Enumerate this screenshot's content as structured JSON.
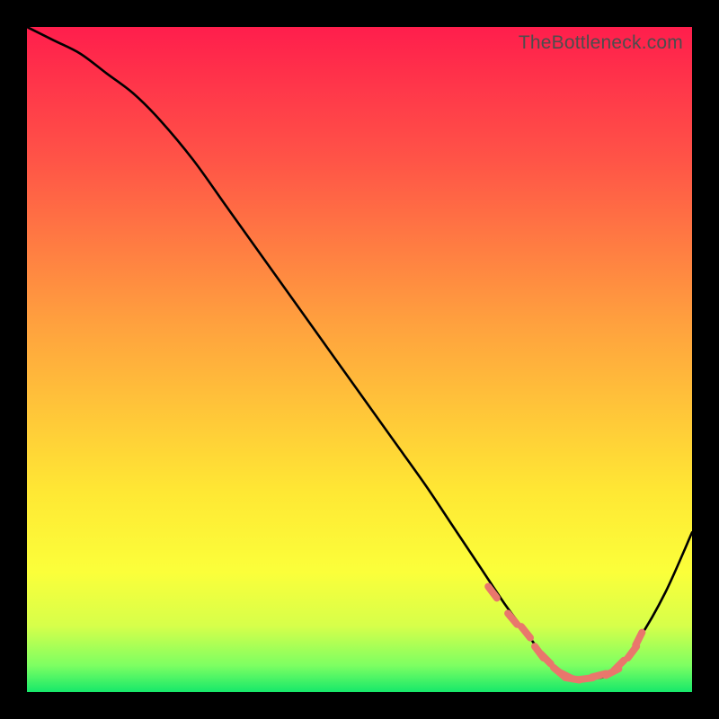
{
  "watermark": "TheBottleneck.com",
  "chart_data": {
    "type": "line",
    "title": "",
    "xlabel": "",
    "ylabel": "",
    "xlim": [
      0,
      100
    ],
    "ylim": [
      0,
      100
    ],
    "gradient_stops": [
      {
        "pos": 0.0,
        "color": "#ff1e4c"
      },
      {
        "pos": 0.2,
        "color": "#ff5447"
      },
      {
        "pos": 0.45,
        "color": "#ffa23e"
      },
      {
        "pos": 0.7,
        "color": "#ffe834"
      },
      {
        "pos": 0.82,
        "color": "#fbff3a"
      },
      {
        "pos": 0.9,
        "color": "#d7ff4a"
      },
      {
        "pos": 0.96,
        "color": "#7dff62"
      },
      {
        "pos": 1.0,
        "color": "#16e86a"
      }
    ],
    "series": [
      {
        "name": "bottleneck-curve",
        "x": [
          0,
          4,
          8,
          12,
          16,
          20,
          25,
          30,
          35,
          40,
          45,
          50,
          55,
          60,
          64,
          68,
          72,
          75,
          78,
          80,
          82,
          85,
          88,
          92,
          96,
          100
        ],
        "y": [
          100,
          98,
          96,
          93,
          90,
          86,
          80,
          73,
          66,
          59,
          52,
          45,
          38,
          31,
          25,
          19,
          13,
          9,
          5,
          3,
          2,
          2,
          3,
          8,
          15,
          24
        ]
      }
    ],
    "markers": {
      "name": "optimal-range",
      "color": "#e9776c",
      "points": [
        {
          "x": 70,
          "y": 15
        },
        {
          "x": 73,
          "y": 11
        },
        {
          "x": 75,
          "y": 9
        },
        {
          "x": 77,
          "y": 6
        },
        {
          "x": 78,
          "y": 5
        },
        {
          "x": 80,
          "y": 3
        },
        {
          "x": 81,
          "y": 2.5
        },
        {
          "x": 82,
          "y": 2
        },
        {
          "x": 84,
          "y": 2
        },
        {
          "x": 86,
          "y": 2.5
        },
        {
          "x": 88,
          "y": 3
        },
        {
          "x": 89,
          "y": 4
        },
        {
          "x": 91,
          "y": 6
        },
        {
          "x": 92,
          "y": 8
        }
      ]
    }
  }
}
